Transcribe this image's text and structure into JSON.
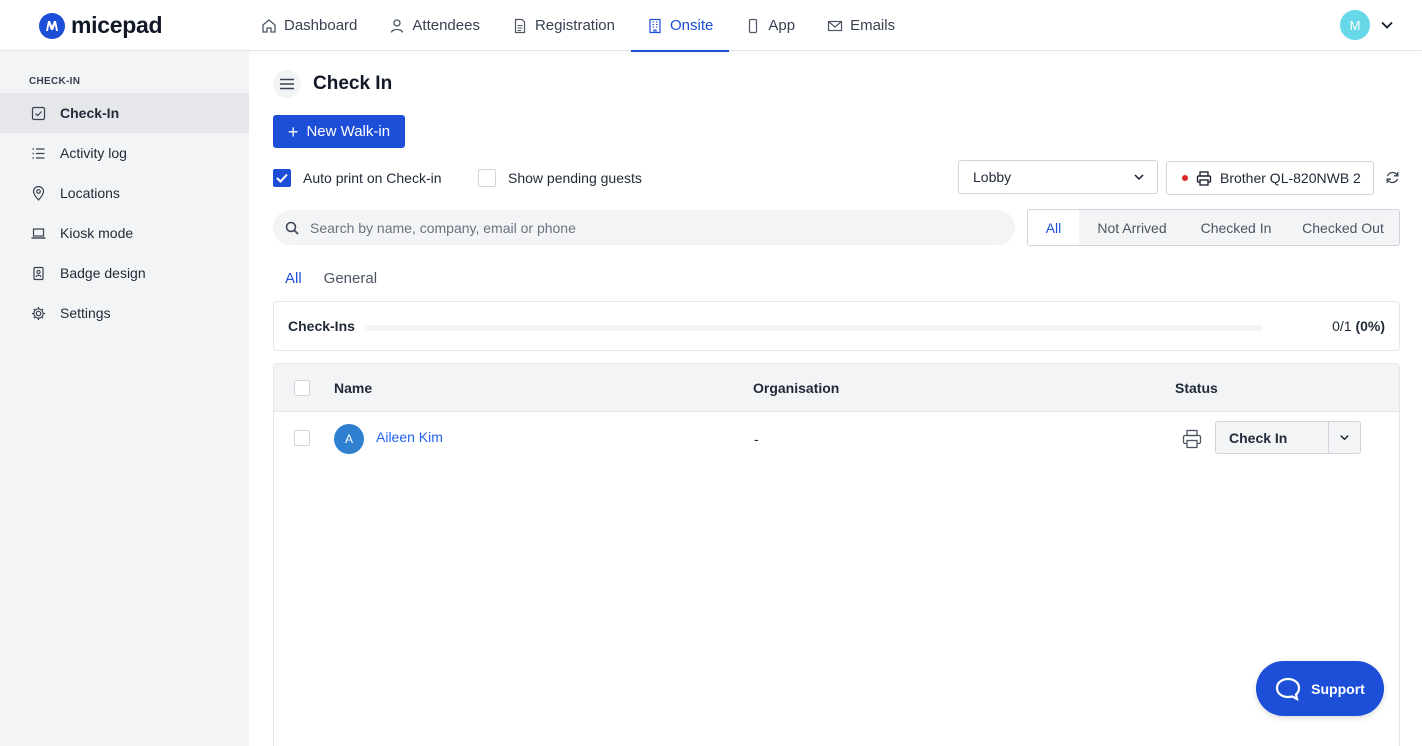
{
  "app": {
    "logo_text": "micepad"
  },
  "nav": {
    "items": [
      {
        "label": "Dashboard",
        "icon": "home-icon"
      },
      {
        "label": "Attendees",
        "icon": "user-icon"
      },
      {
        "label": "Registration",
        "icon": "document-icon"
      },
      {
        "label": "Onsite",
        "icon": "building-icon",
        "active": true
      },
      {
        "label": "App",
        "icon": "phone-icon"
      },
      {
        "label": "Emails",
        "icon": "mail-icon"
      }
    ],
    "avatar_initial": "M"
  },
  "sidebar": {
    "heading": "CHECK-IN",
    "items": [
      {
        "label": "Check-In",
        "icon": "check-square-icon",
        "active": true
      },
      {
        "label": "Activity log",
        "icon": "list-icon"
      },
      {
        "label": "Locations",
        "icon": "location-pin-icon"
      },
      {
        "label": "Kiosk mode",
        "icon": "laptop-icon"
      },
      {
        "label": "Badge design",
        "icon": "badge-icon"
      },
      {
        "label": "Settings",
        "icon": "gear-icon"
      }
    ]
  },
  "main": {
    "title": "Check In",
    "new_walkin_label": "New Walk-in",
    "auto_print_label": "Auto print on Check-in",
    "auto_print_checked": true,
    "show_pending_label": "Show pending guests",
    "show_pending_checked": false,
    "location_select": "Lobby",
    "printer_label": "Brother QL-820NWB 2",
    "printer_status_color": "#dc2626",
    "search_placeholder": "Search by name, company, email or phone",
    "filters": [
      {
        "label": "All",
        "active": true
      },
      {
        "label": "Not Arrived"
      },
      {
        "label": "Checked In"
      },
      {
        "label": "Checked Out"
      }
    ],
    "subtabs": [
      {
        "label": "All",
        "active": true
      },
      {
        "label": "General"
      }
    ],
    "progress": {
      "label": "Check-Ins",
      "count": "0/1",
      "percent_text": "(0%)",
      "fraction": 0
    },
    "table": {
      "columns": [
        "Name",
        "Organisation",
        "Status"
      ],
      "rows": [
        {
          "initial": "A",
          "name": "Aileen Kim",
          "organisation": "-",
          "status_action": "Check In"
        }
      ]
    }
  },
  "support": {
    "label": "Support"
  },
  "colors": {
    "accent": "#1d4ed8"
  }
}
